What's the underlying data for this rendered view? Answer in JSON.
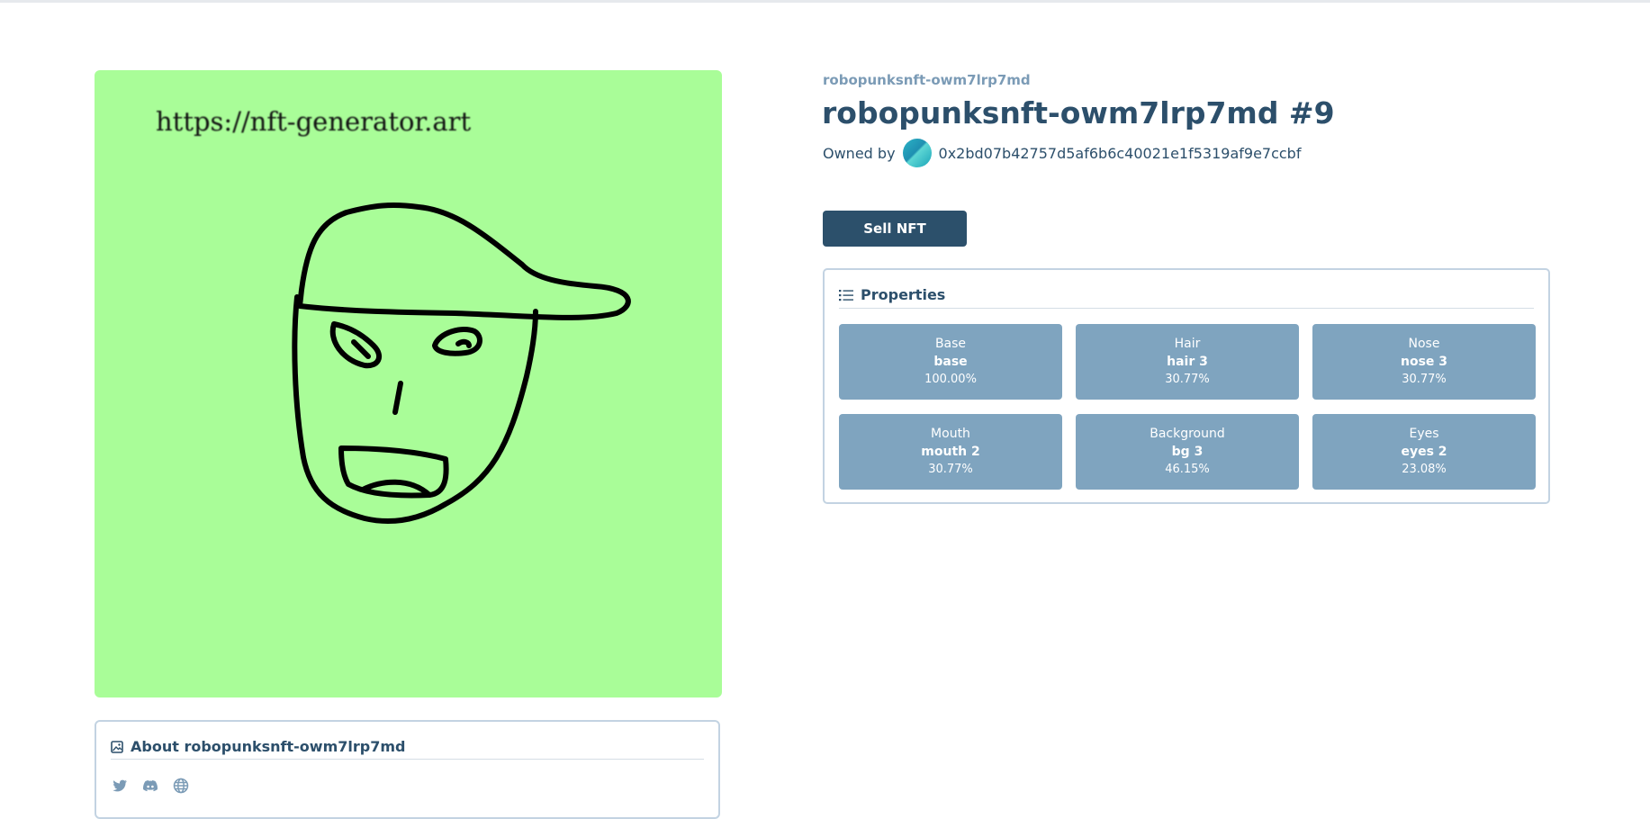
{
  "nft": {
    "collection": "robopunksnft-owm7lrp7md",
    "title": "robopunksnft-owm7lrp7md #9",
    "owned_by_label": "Owned by",
    "owner_address": "0x2bd07b42757d5af6b6c40021e1f5319af9e7ccbf",
    "image": {
      "background_color": "#a9fd98",
      "watermark_text": "https://nft-generator.art"
    }
  },
  "actions": {
    "sell_label": "Sell NFT"
  },
  "properties": {
    "heading": "Properties",
    "icon": "list-icon",
    "items": [
      {
        "type": "Base",
        "value": "base",
        "rarity": "100.00%"
      },
      {
        "type": "Hair",
        "value": "hair 3",
        "rarity": "30.77%"
      },
      {
        "type": "Nose",
        "value": "nose 3",
        "rarity": "30.77%"
      },
      {
        "type": "Mouth",
        "value": "mouth 2",
        "rarity": "30.77%"
      },
      {
        "type": "Background",
        "value": "bg 3",
        "rarity": "46.15%"
      },
      {
        "type": "Eyes",
        "value": "eyes 2",
        "rarity": "23.08%"
      }
    ]
  },
  "about": {
    "heading": "About robopunksnft-owm7lrp7md",
    "icon": "image-icon",
    "links": [
      "twitter-icon",
      "discord-icon",
      "globe-icon"
    ]
  },
  "colors": {
    "primary": "#2c506b",
    "tile": "#7fa4bf",
    "muted": "#7b9bb6",
    "border": "#c3d3e2"
  }
}
